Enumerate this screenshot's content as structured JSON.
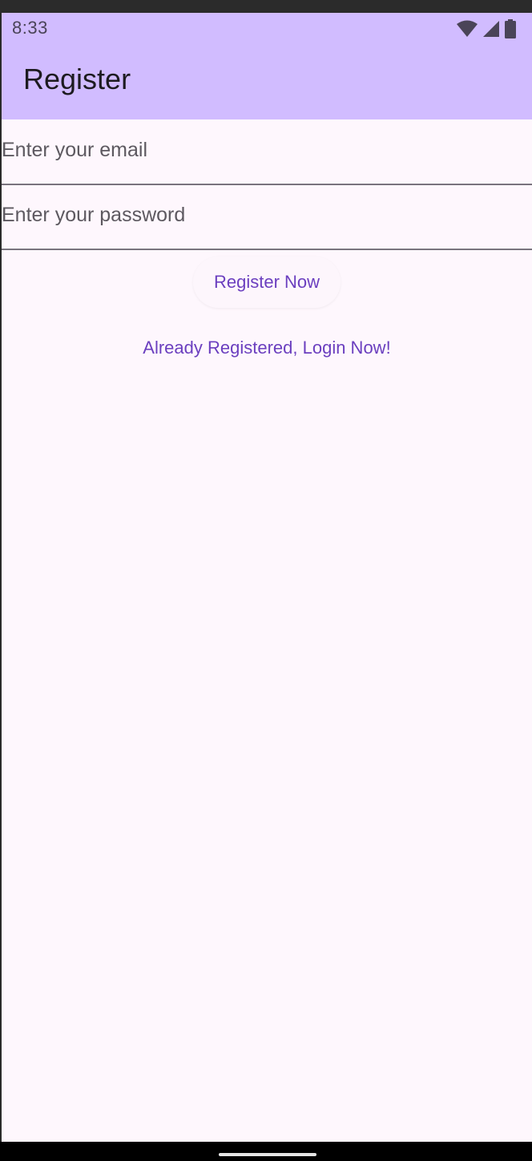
{
  "status_bar": {
    "time": "8:33",
    "icons": [
      "wifi-icon",
      "cell-signal-icon",
      "battery-icon"
    ]
  },
  "toolbar": {
    "title": "Register"
  },
  "form": {
    "email": {
      "value": "",
      "placeholder": "Enter your email"
    },
    "password": {
      "value": "",
      "placeholder": "Enter your password"
    },
    "register_label": "Register Now",
    "login_link_label": "Already Registered, Login Now!"
  },
  "colors": {
    "app_bar": "#d1bcff",
    "background": "#fef7fd",
    "accent": "#6b3fbf",
    "divider": "#79747e"
  }
}
